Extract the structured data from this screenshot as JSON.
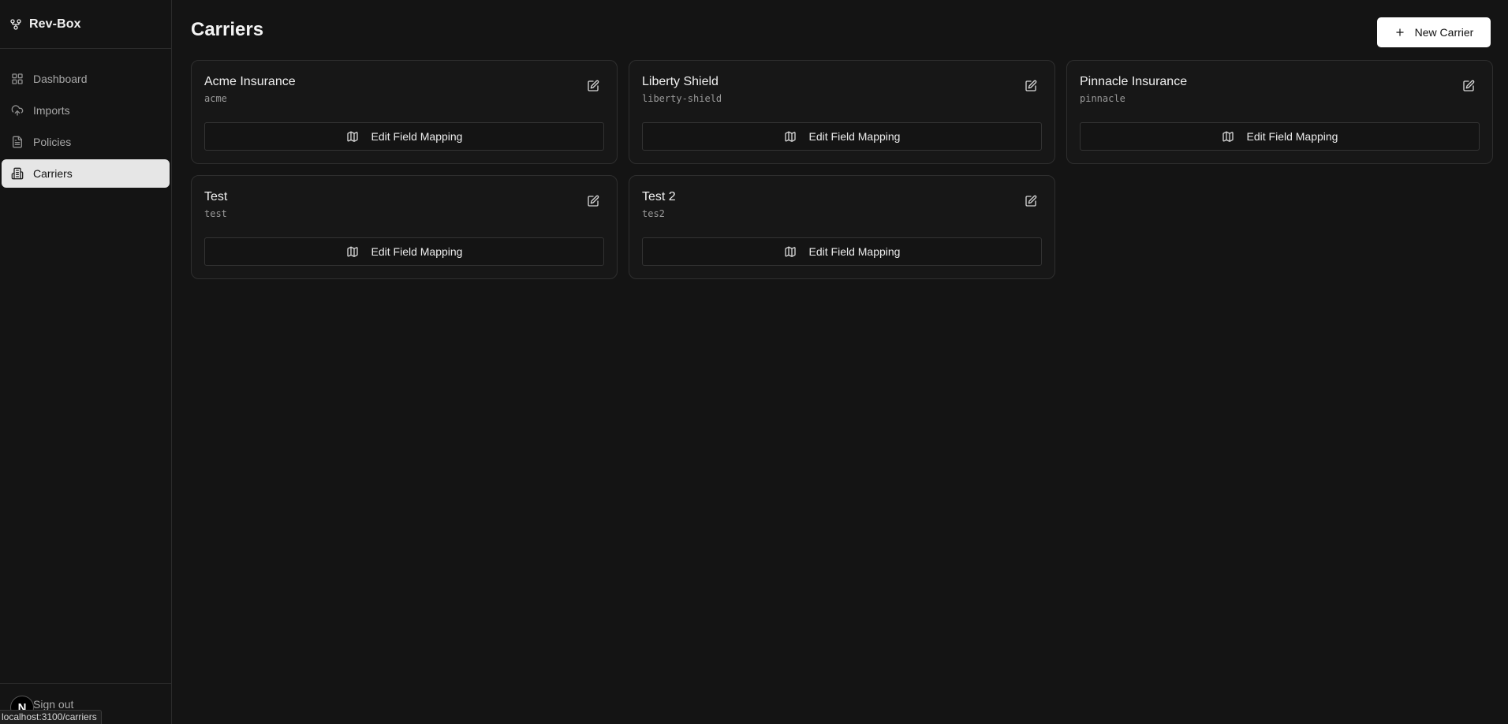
{
  "app": {
    "name": "Rev-Box",
    "logo_icon": "git-fork-icon"
  },
  "sidebar": {
    "items": [
      {
        "label": "Dashboard",
        "icon": "layout-grid-icon",
        "active": false
      },
      {
        "label": "Imports",
        "icon": "cloud-upload-icon",
        "active": false
      },
      {
        "label": "Policies",
        "icon": "file-text-icon",
        "active": false
      },
      {
        "label": "Carriers",
        "icon": "building-icon",
        "active": true
      }
    ],
    "sign_out_label": "Sign out",
    "avatar_letter": "N"
  },
  "page": {
    "title": "Carriers",
    "new_button_label": "New Carrier"
  },
  "carriers": [
    {
      "name": "Acme Insurance",
      "slug": "acme",
      "mapping_label": "Edit Field Mapping"
    },
    {
      "name": "Liberty Shield",
      "slug": "liberty-shield",
      "mapping_label": "Edit Field Mapping"
    },
    {
      "name": "Pinnacle Insurance",
      "slug": "pinnacle",
      "mapping_label": "Edit Field Mapping"
    },
    {
      "name": "Test",
      "slug": "test",
      "mapping_label": "Edit Field Mapping"
    },
    {
      "name": "Test 2",
      "slug": "tes2",
      "mapping_label": "Edit Field Mapping"
    }
  ],
  "status_bar": {
    "url": "localhost:3100/carriers"
  },
  "colors": {
    "background": "#141414",
    "active_nav": "#e6e6e6",
    "primary_button": "#ffffff"
  }
}
